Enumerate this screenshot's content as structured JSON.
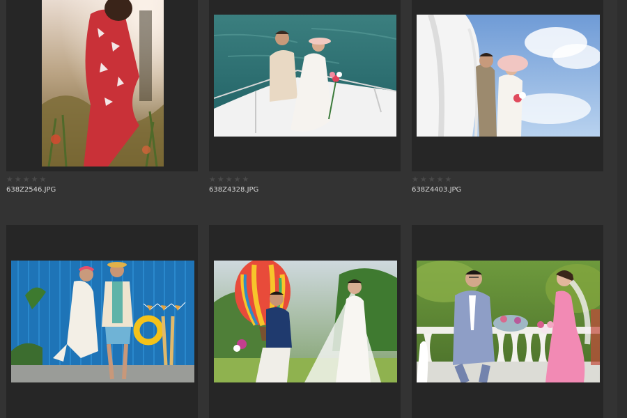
{
  "grid": {
    "items": [
      {
        "filename": "638Z2546.JPG",
        "rating": 0,
        "scene": "portrait-garden"
      },
      {
        "filename": "638Z4328.JPG",
        "rating": 0,
        "scene": "couple-on-boat"
      },
      {
        "filename": "638Z4403.JPG",
        "rating": 0,
        "scene": "couple-by-white-hull"
      },
      {
        "filename": "",
        "rating": 0,
        "scene": "couple-blue-wall"
      },
      {
        "filename": "",
        "rating": 0,
        "scene": "couple-balloon-park"
      },
      {
        "filename": "",
        "rating": 0,
        "scene": "couple-pink-dress-terrace"
      }
    ]
  },
  "icons": {
    "rating_star": "★"
  },
  "colors": {
    "background": "#333333",
    "card": "#262626",
    "filename_text": "#d6d6d6",
    "empty_star": "#4a4a4a"
  }
}
